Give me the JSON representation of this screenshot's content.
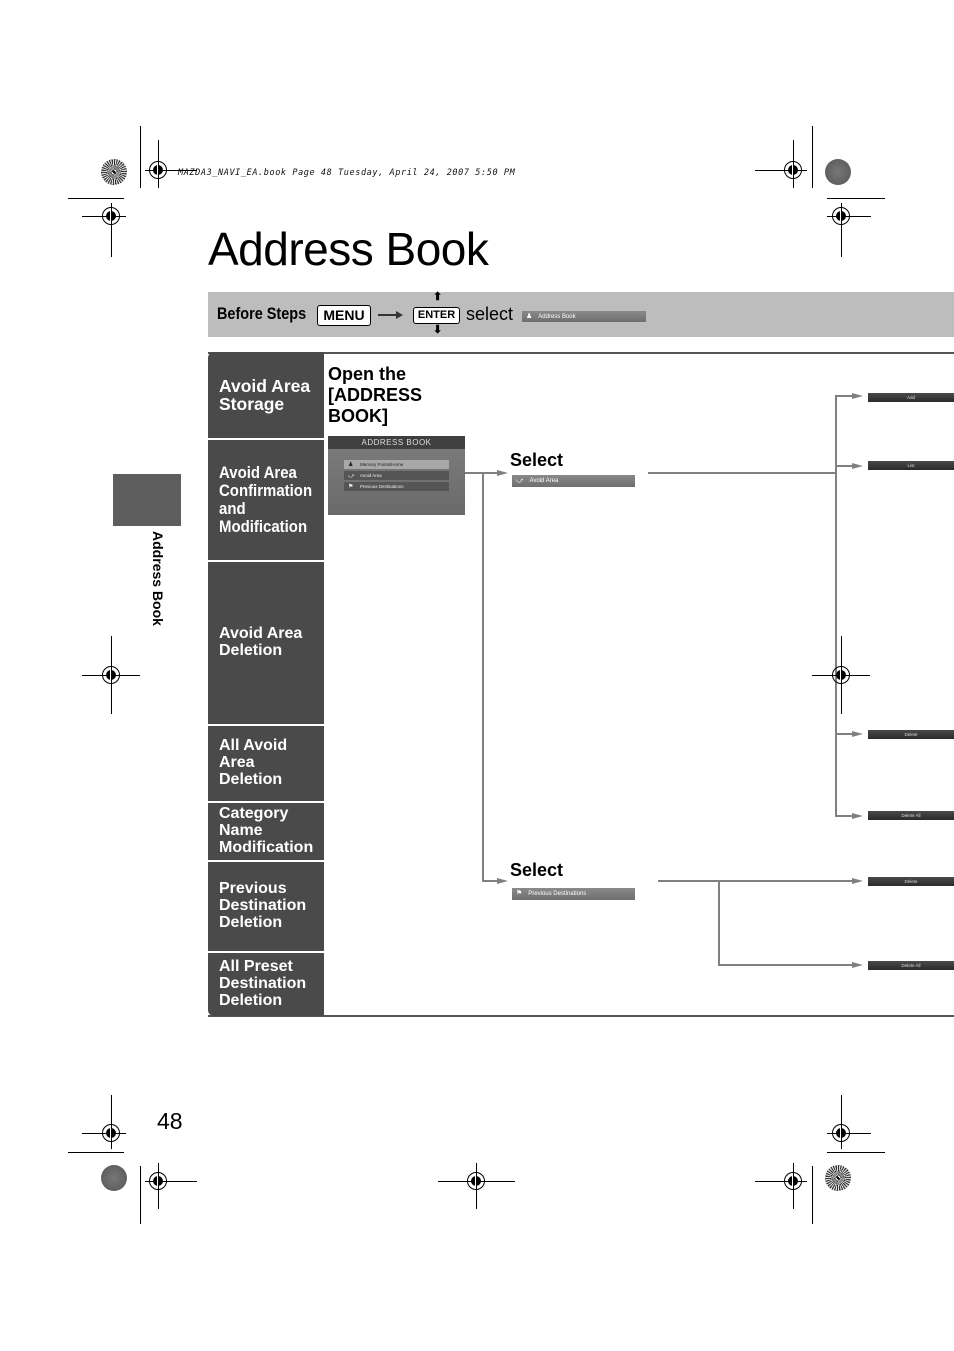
{
  "print_header": "MAZDA3_NAVI_EA.book  Page 48  Tuesday, April 24, 2007  5:50 PM",
  "page_title": "Address Book",
  "before_steps": {
    "label": "Before Steps",
    "menu_key": "MENU",
    "enter_key": "ENTER",
    "up_arrow": "⬆",
    "down_arrow": "⬇",
    "select_text": "select",
    "screen_item": {
      "icon": "person-pin-icon",
      "glyph": "♟",
      "label": "Address Book"
    }
  },
  "categories": [
    {
      "label": "Avoid Area\nStorage"
    },
    {
      "label": "Avoid Area\nConfirmation\nand\nModification"
    },
    {
      "label": "Avoid Area\nDeletion"
    },
    {
      "label": "All Avoid\nArea\nDeletion"
    },
    {
      "label": "Category\nName\nModification"
    },
    {
      "label": "Previous\nDestination\nDeletion"
    },
    {
      "label": "All Preset\nDestination\nDeletion"
    }
  ],
  "step1": {
    "instruction": "Open the\n[ADDRESS\nBOOK]",
    "screen": {
      "title": "ADDRESS BOOK",
      "items": [
        {
          "glyph": "♟",
          "icon": "memory-point-icon",
          "label": "Memory Points/Home"
        },
        {
          "glyph": "⤻",
          "icon": "avoid-area-icon",
          "label": "Avoid Area"
        },
        {
          "glyph": "⚑",
          "icon": "previous-destination-icon",
          "label": "Previous Destinations"
        }
      ]
    }
  },
  "branch_avoid": {
    "select_label": "Select",
    "screen_item": {
      "glyph": "⤻",
      "label": "Avoid Area"
    }
  },
  "branch_previous": {
    "select_label": "Select",
    "screen_item": {
      "glyph": "⚑",
      "label": "Previous Destinations"
    }
  },
  "actions": {
    "add": "Add",
    "list": "List",
    "delete_avoid": "Delete",
    "delete_all_avoid": "Delete All",
    "delete_prev": "Delete",
    "delete_all_prev": "Delete All"
  },
  "side_tab": "Address Book",
  "page_number": "48"
}
